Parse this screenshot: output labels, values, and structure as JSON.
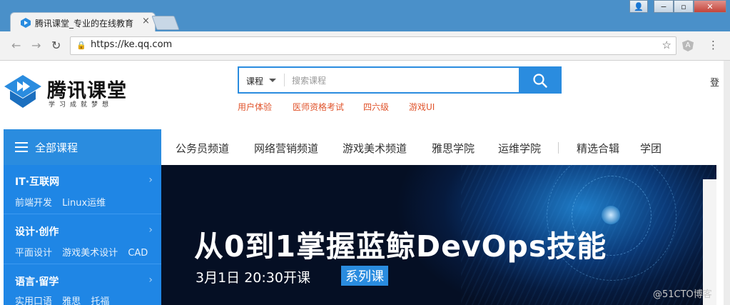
{
  "browser": {
    "tab_title": "腾讯课堂_专业的在线教育",
    "tab_close": "×",
    "url": "https://ke.qq.com",
    "window_buttons": [
      "👤",
      "−",
      "▫",
      "✕"
    ],
    "ext_icon": "A"
  },
  "site": {
    "logo_name": "腾讯课堂",
    "logo_slogan": "学习成就梦想",
    "search": {
      "category": "课程",
      "placeholder": "搜索课程"
    },
    "hot_keywords": [
      "用户体验",
      "医师资格考试",
      "四六级",
      "游戏UI"
    ],
    "right_cut_text": "登"
  },
  "sidebar": {
    "header": "全部课程",
    "categories": [
      {
        "title": "IT·互联网",
        "subs": [
          "前端开发",
          "Linux运维"
        ]
      },
      {
        "title": "设计·创作",
        "subs": [
          "平面设计",
          "游戏美术设计",
          "CAD"
        ]
      },
      {
        "title": "语言·留学",
        "subs": [
          "实用口语",
          "雅思",
          "托福"
        ]
      }
    ]
  },
  "topnav": [
    "公务员频道",
    "网络营销频道",
    "游戏美术频道",
    "雅思学院",
    "运维学院",
    "精选合辑",
    "学团"
  ],
  "banner": {
    "headline": "从0到1掌握蓝鲸DevOps技能",
    "date": "3月1日 20:30开课",
    "badge": "系列课"
  },
  "watermark": "@51CTO博客",
  "colors": {
    "accent": "#2a8cdf",
    "sidebar": "#1f86e5",
    "hot_keyword": "#e0542c",
    "chrome_frame": "#4a90c9"
  }
}
